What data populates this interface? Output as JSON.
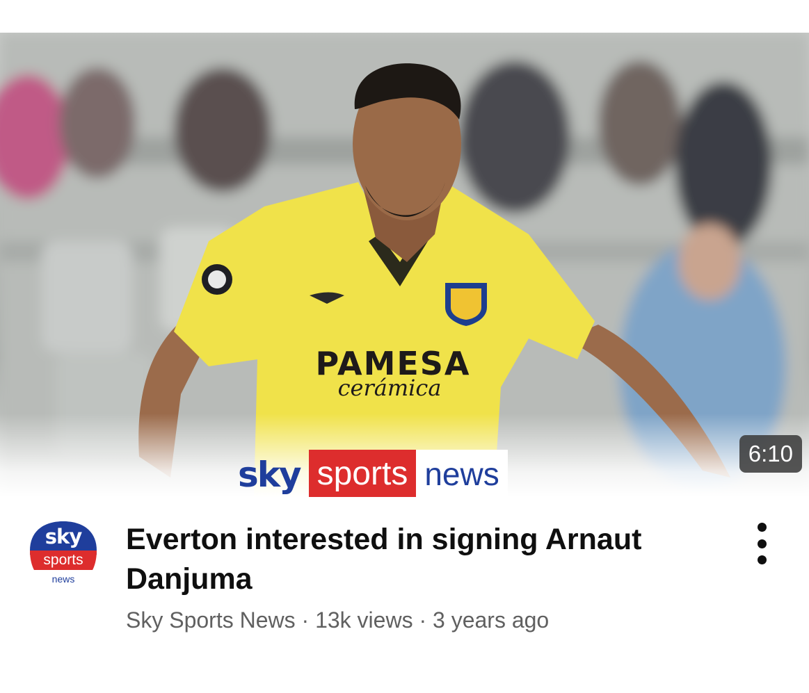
{
  "video": {
    "thumbnail": {
      "kit_sponsor": "PAMESA",
      "kit_sponsor_sub": "cerámica",
      "channel_brand": {
        "sky": "sky",
        "sports": "sports",
        "news": "news"
      }
    },
    "duration": "6:10",
    "title": "Everton interested in signing Arnaut Danjuma",
    "channel_avatar": {
      "sky": "sky",
      "sports": "sports",
      "news": "news"
    },
    "meta": {
      "channel": "Sky Sports News",
      "separator": "·",
      "views": "13k views",
      "age": "3 years ago"
    },
    "more_icon": "more-vertical-icon"
  },
  "colors": {
    "sky_blue": "#1f3e9c",
    "sky_red": "#dd2d2d",
    "kit_yellow": "#f0e24a",
    "meta_grey": "#606060"
  }
}
